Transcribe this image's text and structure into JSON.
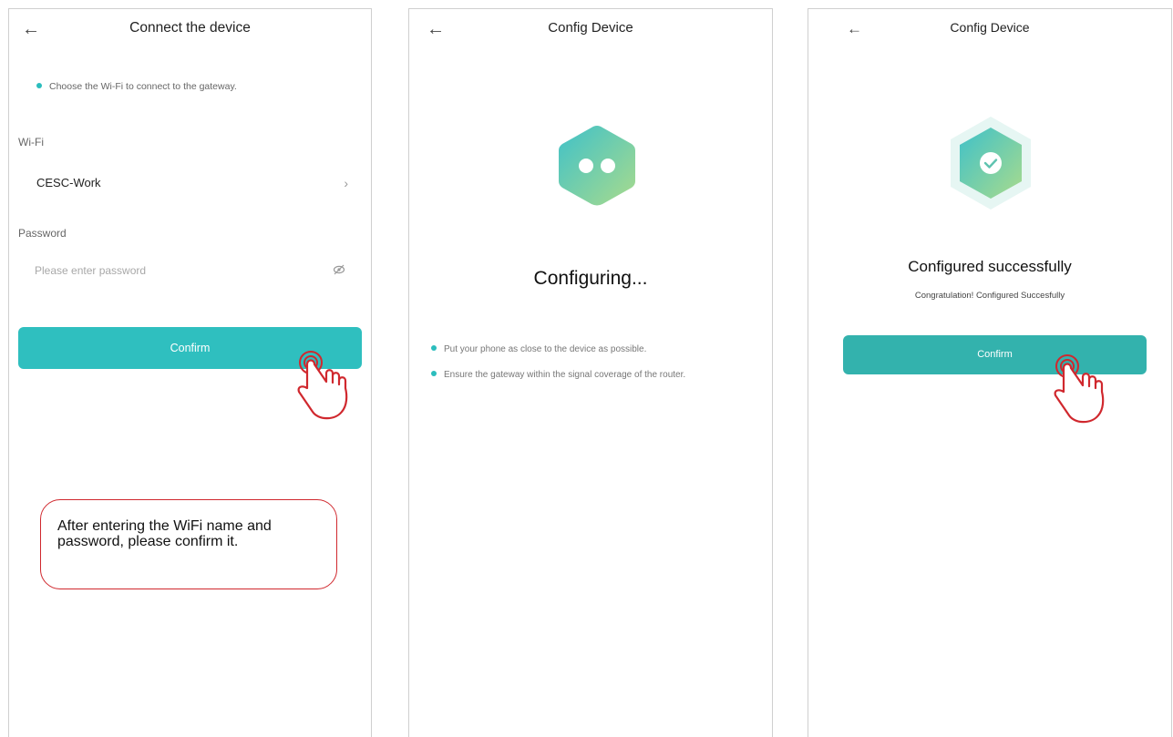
{
  "screens": [
    {
      "title": "Connect the device",
      "hint": "Choose the Wi-Fi to connect to the gateway.",
      "wifi_label": "Wi-Fi",
      "wifi_value": "CESC-Work",
      "password_label": "Password",
      "password_placeholder": "Please enter password",
      "confirm_label": "Confirm",
      "note": "After entering the WiFi name and password, please confirm it."
    },
    {
      "title": "Config Device",
      "status": "Configuring...",
      "tips": [
        "Put your phone as close to the device as possible.",
        "Ensure the gateway within the signal coverage of the router."
      ]
    },
    {
      "title": "Config Device",
      "status": "Configured successfully",
      "subtitle": "Congratulation! Configured Succesfully",
      "confirm_label": "Confirm"
    }
  ],
  "icons": {
    "back": "arrow-left-icon",
    "chevron": "chevron-right-icon",
    "eye_off": "eye-off-icon",
    "device": "hexagon-device-icon",
    "success": "hexagon-check-icon",
    "hand": "tap-hand-icon"
  },
  "colors": {
    "accent": "#2fbfbf",
    "confirm_dark": "#33b2ad",
    "annotation_red": "#d0282e",
    "hex_gradient_start": "#3fc1c9",
    "hex_gradient_end": "#a9db8c"
  }
}
